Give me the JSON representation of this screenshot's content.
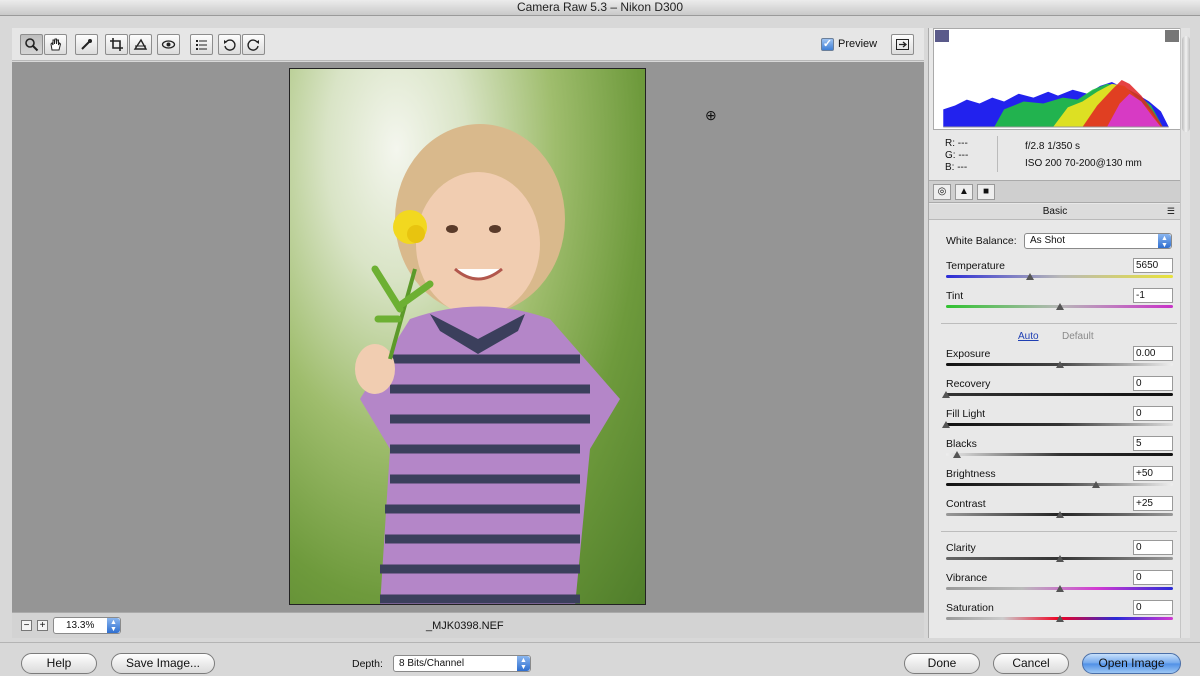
{
  "window": {
    "title": "Camera Raw 5.3  –  Nikon D300"
  },
  "toolbar": {
    "tools": [
      {
        "name": "zoom-tool",
        "icon": "magnifier-icon"
      },
      {
        "name": "hand-tool",
        "icon": "hand-icon"
      },
      {
        "name": "white-balance-tool",
        "icon": "eyedropper-icon"
      },
      {
        "name": "crop-tool",
        "icon": "crop-icon"
      },
      {
        "name": "straighten-tool",
        "icon": "straighten-icon"
      },
      {
        "name": "red-eye-tool",
        "icon": "eye-icon"
      },
      {
        "name": "preferences-tool",
        "icon": "list-icon"
      },
      {
        "name": "rotate-ccw-tool",
        "icon": "rotate-left-icon"
      },
      {
        "name": "rotate-cw-tool",
        "icon": "rotate-right-icon"
      }
    ],
    "preview_label": "Preview",
    "preview_checked": true
  },
  "status": {
    "zoom": "13.3%",
    "filename": "_MJK0398.NEF",
    "zoom_out": "−",
    "zoom_in": "+"
  },
  "readout": {
    "r": "R:  ---",
    "g": "G:  ---",
    "b": "B:  ---",
    "exif_line1": "f/2.8    1/350 s",
    "exif_line2": "ISO 200    70-200@130 mm"
  },
  "panel": {
    "title": "Basic",
    "white_balance_label": "White Balance:",
    "white_balance_value": "As Shot",
    "auto_label": "Auto",
    "default_label": "Default",
    "sliders": {
      "temperature": {
        "label": "Temperature",
        "value": "5650",
        "level": 0.37
      },
      "tint": {
        "label": "Tint",
        "value": "-1",
        "level": 0.5
      },
      "exposure": {
        "label": "Exposure",
        "value": "0.00",
        "level": 0.5
      },
      "recovery": {
        "label": "Recovery",
        "value": "0",
        "level": 0.0
      },
      "fill_light": {
        "label": "Fill Light",
        "value": "0",
        "level": 0.0
      },
      "blacks": {
        "label": "Blacks",
        "value": "5",
        "level": 0.05
      },
      "brightness": {
        "label": "Brightness",
        "value": "+50",
        "level": 0.66
      },
      "contrast": {
        "label": "Contrast",
        "value": "+25",
        "level": 0.5
      },
      "clarity": {
        "label": "Clarity",
        "value": "0",
        "level": 0.5
      },
      "vibrance": {
        "label": "Vibrance",
        "value": "0",
        "level": 0.5
      },
      "saturation": {
        "label": "Saturation",
        "value": "0",
        "level": 0.5
      }
    }
  },
  "footer": {
    "help": "Help",
    "save_image": "Save Image...",
    "depth_label": "Depth:",
    "depth_value": "8 Bits/Channel",
    "done": "Done",
    "cancel": "Cancel",
    "open_image": "Open Image"
  },
  "colors": {
    "accent": "#3e7fd6",
    "canvas": "#959595",
    "panel": "#e8e8e8"
  }
}
